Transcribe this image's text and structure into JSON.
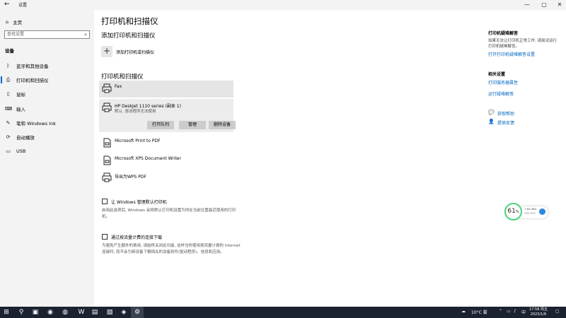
{
  "window": {
    "title": "设置",
    "back_glyph": "←",
    "minimize_glyph": "—",
    "maximize_glyph": "▢",
    "close_glyph": "✕"
  },
  "sidebar": {
    "home_label": "主页",
    "search_placeholder": "查找设置",
    "section_title": "设备",
    "items": [
      {
        "label": "蓝牙和其他设备",
        "icon": "bluetooth-icon"
      },
      {
        "label": "打印机和扫描仪",
        "icon": "printer-icon",
        "active": true
      },
      {
        "label": "鼠标",
        "icon": "mouse-icon"
      },
      {
        "label": "输入",
        "icon": "keyboard-icon"
      },
      {
        "label": "笔和 Windows Ink",
        "icon": "pen-icon"
      },
      {
        "label": "自动播放",
        "icon": "autoplay-icon"
      },
      {
        "label": "USB",
        "icon": "usb-icon"
      }
    ]
  },
  "main": {
    "title": "打印机和扫描仪",
    "add_heading": "添加打印机和扫描仪",
    "add_label": "添加打印机或扫描仪",
    "list_heading": "打印机和扫描仪",
    "printers": [
      {
        "name": "Fax",
        "status": ""
      },
      {
        "name": "HP DeskJet 1110 series (副本 1)",
        "status": "默认, 驱动程序无法使用"
      },
      {
        "name": "Microsoft Print to PDF",
        "status": ""
      },
      {
        "name": "Microsoft XPS Document Writer",
        "status": ""
      },
      {
        "name": "导出为WPS PDF",
        "status": ""
      }
    ],
    "buttons": {
      "open_queue": "打开队列",
      "manage": "管理",
      "remove": "删除设备"
    },
    "let_windows_label": "让 Windows 管理默认打印机",
    "let_windows_desc": "启用此选项后, Windows 会将默认打印机设置为你在当前位置最近使用的打印机。",
    "metered_label": "通过按流量计费的连接下载",
    "metered_desc": "为避免产生额外的费用, 请始终关闭此功能, 这样当你使用按流量计费的 Internet 连接时, 就不会为新设备下载相关的设备软件(驱动程序)、信息和应用。"
  },
  "right": {
    "troubleshoot_title": "打印机疑难解答",
    "troubleshoot_text": "如果无法让打印机正常工作, 请尝试运行打印机疑难解答。",
    "troubleshoot_link": "打开打印机疑难解答设置",
    "related_title": "相关设置",
    "related_links": [
      "打印服务器属性",
      "运行疑难解答"
    ],
    "help_link": "获取帮助",
    "feedback_link": "提供反馈"
  },
  "widget": {
    "percent": "61",
    "percent_unit": "%",
    "up_speed": "↑ 82.4K/s",
    "cpu": "CPU 29℃"
  },
  "taskbar": {
    "weather": "10°C 雾",
    "ime": "中",
    "time": "17:58 周五",
    "date": "2023/1/6"
  },
  "colors": {
    "accent": "#0067c0",
    "sidebar_bg": "#f3f3f3",
    "taskbar_bg": "#1b2230",
    "widget_ring": "#4cd47a"
  }
}
